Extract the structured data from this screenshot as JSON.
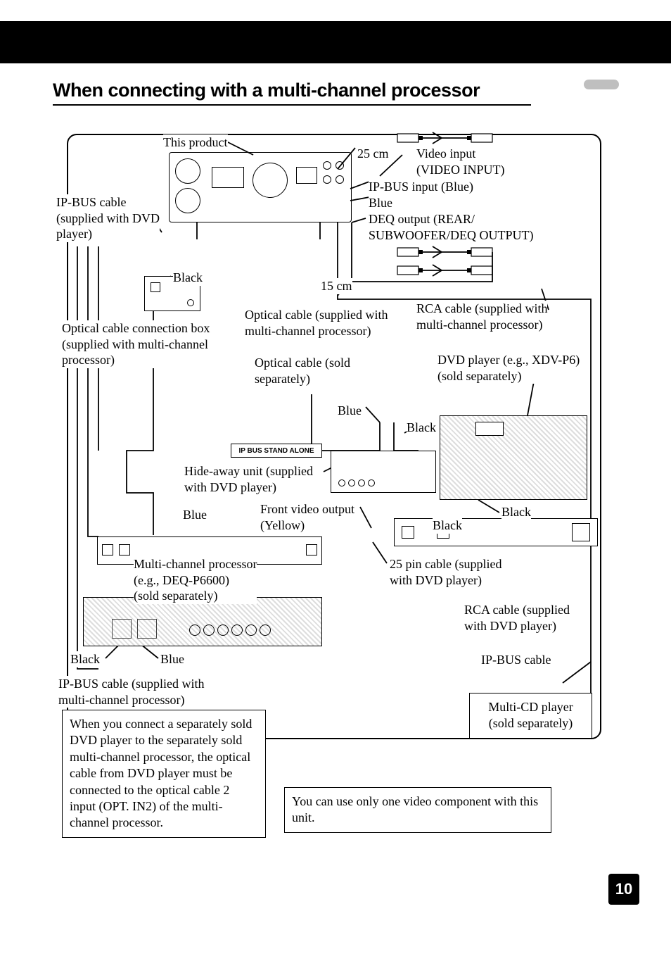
{
  "header": {
    "title": "When connecting with a multi-channel processor"
  },
  "pageNumber": "10",
  "labels": {
    "thisProduct": "This product",
    "cm25": "25 cm",
    "videoInput": "Video input\n(VIDEO INPUT)",
    "ipBusInputBlue": "IP-BUS input (Blue)",
    "blue1": "Blue",
    "deqOutput": "DEQ output (REAR/\nSUBWOOFER/DEQ OUTPUT)",
    "ipBusCableDvd": "IP-BUS cable\n(supplied with DVD\nplayer)",
    "black1": "Black",
    "cm15": "15 cm",
    "opticalBox": "Optical cable connection box\n(supplied with multi-channel\nprocessor)",
    "opticalSupplied": "Optical cable (supplied with\nmulti-channel processor)",
    "rcaSupplied": "RCA cable (supplied with\nmulti-channel processor)",
    "opticalSold": "Optical cable (sold\nseparately)",
    "dvdPlayer": "DVD player (e.g., XDV-P6)\n(sold separately)",
    "blue2": "Blue",
    "black2": "Black",
    "ipBusStandAlone": "IP BUS    STAND ALONE",
    "hideAway": "Hide-away unit (supplied\nwith DVD player)",
    "blue3": "Blue",
    "frontVideo": "Front video output\n(Yellow)",
    "black3": "Black",
    "black4": "Black",
    "multiChannel": "Multi-channel processor\n(e.g., DEQ-P6600)\n(sold separately)",
    "pin25": "25 pin cable (supplied\nwith DVD player)",
    "rcaDvd": "RCA cable (supplied\nwith DVD player)",
    "black5": "Black",
    "blue4": "Blue",
    "ipBusCable": "IP-BUS cable",
    "ipBusCableMcp": "IP-BUS cable (supplied with\nmulti-channel processor)",
    "multiCd": "Multi-CD player\n(sold separately)"
  },
  "notes": {
    "note1": "When you connect a separately sold DVD player to the separately sold multi-channel processor, the optical cable from DVD player must be connected to the optical cable 2 input (OPT. IN2) of the multi-channel processor.",
    "note2": "You can use only one video component with this unit."
  }
}
